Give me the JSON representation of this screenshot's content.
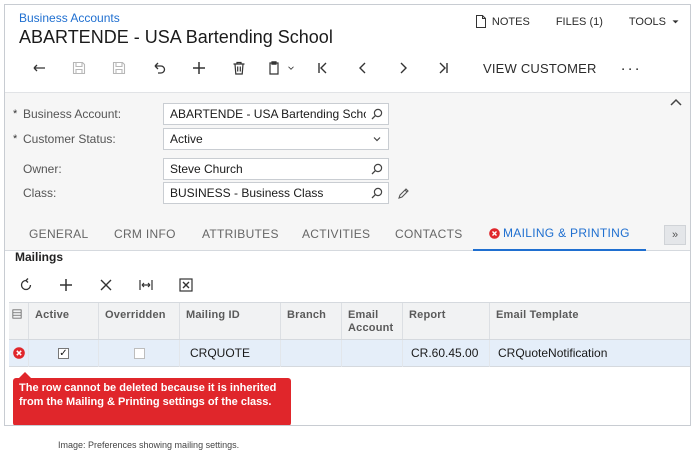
{
  "header": {
    "breadcrumb": "Business Accounts",
    "title": "ABARTENDE - USA Bartending School",
    "notes_label": "NOTES",
    "files_label": "FILES (1)",
    "tools_label": "TOOLS"
  },
  "toolbar": {
    "view_customer_label": "VIEW CUSTOMER",
    "more_label": "···"
  },
  "form": {
    "business_account": {
      "label": "Business Account:",
      "value": "ABARTENDE - USA Bartending Schoo"
    },
    "customer_status": {
      "label": "Customer Status:",
      "value": "Active"
    },
    "owner": {
      "label": "Owner:",
      "value": "Steve Church"
    },
    "class": {
      "label": "Class:",
      "value": "BUSINESS - Business Class"
    },
    "required_mark": "*"
  },
  "tabs": [
    {
      "label": "GENERAL"
    },
    {
      "label": "CRM INFO"
    },
    {
      "label": "ATTRIBUTES"
    },
    {
      "label": "ACTIVITIES"
    },
    {
      "label": "CONTACTS"
    },
    {
      "label": "MAILING & PRINTING"
    }
  ],
  "tab_scroll_label": "»",
  "mailings": {
    "title": "Mailings",
    "columns": {
      "active": "Active",
      "overridden": "Overridden",
      "mailing_id": "Mailing ID",
      "branch": "Branch",
      "email_account_1": "Email",
      "email_account_2": "Account",
      "report": "Report",
      "email_template": "Email Template"
    },
    "rows": [
      {
        "active": true,
        "overridden": false,
        "mailing_id": "CRQUOTE",
        "branch": "",
        "email_account": "",
        "report": "CR.60.45.00",
        "email_template": "CRQuoteNotification"
      }
    ],
    "error_tooltip": "The row cannot be deleted because it is inherited from the Mailing & Printing settings of the class."
  },
  "caption": "Image: Preferences showing mailing settings.",
  "colors": {
    "accent": "#1f6fd0",
    "error": "#e0262b",
    "selected_row": "#e5eef9"
  }
}
